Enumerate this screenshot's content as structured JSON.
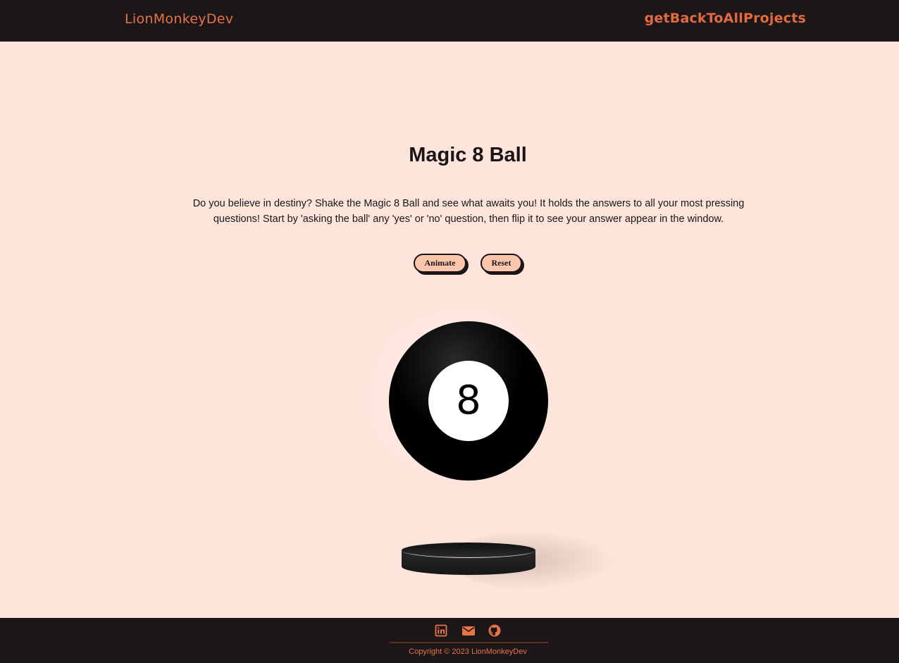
{
  "header": {
    "brand": "LionMonkeyDev",
    "back_link": "getBackToAllProjects"
  },
  "main": {
    "title": "Magic 8 Ball",
    "description": "Do you believe in destiny? Shake the Magic 8 Ball and see what awaits you! It holds the answers to all your most pressing questions! Start by 'asking the ball' any 'yes' or 'no' question, then flip it to see your answer appear in the window.",
    "buttons": {
      "animate": "Animate",
      "reset": "Reset"
    },
    "ball_number": "8"
  },
  "footer": {
    "icons": [
      "linkedin-icon",
      "mail-icon",
      "github-icon"
    ],
    "copyright": "Copyright © 2023 LionMonkeyDev"
  },
  "colors": {
    "background": "#fde5dc",
    "bar": "#1c1619",
    "accent": "#e57545",
    "button": "#fcc6ad"
  }
}
